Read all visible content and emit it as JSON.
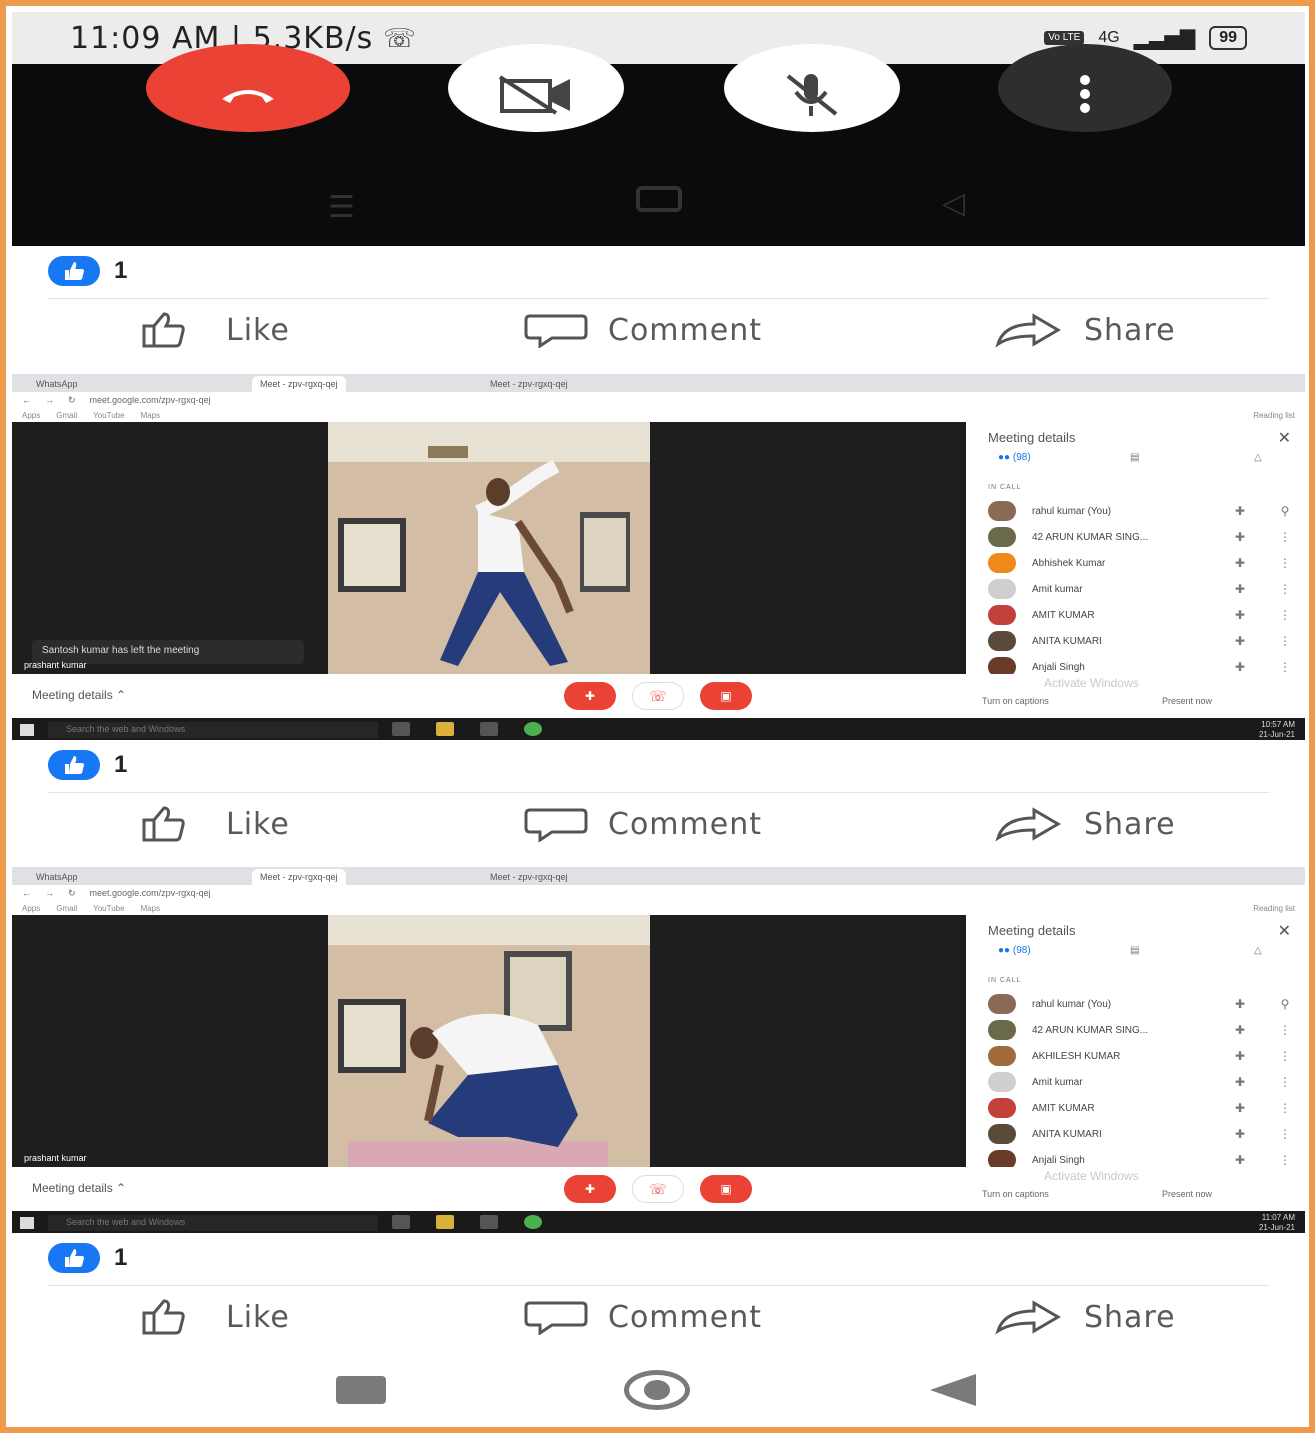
{
  "status_bar": {
    "time": "11:09 AM | 5.3KB/s",
    "network_type": "4G",
    "volte": "Vo LTE",
    "battery": "99"
  },
  "post_actions": {
    "like_count": "1",
    "like_label": "Like",
    "comment_label": "Comment",
    "share_label": "Share"
  },
  "meet_screens": [
    {
      "tabs": [
        "WhatsApp",
        "Meet - zpv-rgxq-qej",
        "Meet - zpv-rgxq-qej"
      ],
      "url": "meet.google.com/zpv-rgxq-qej",
      "bookmarks": [
        "Apps",
        "Gmail",
        "YouTube",
        "Maps",
        "Reading list"
      ],
      "notification": "Santosh kumar has left the meeting",
      "tile_name": "prashant kumar",
      "panel_title": "Meeting details",
      "people_count": "(98)",
      "in_call_label": "IN CALL",
      "participants": [
        "rahul kumar (You)",
        "42 ARUN KUMAR SING...",
        "Abhishek Kumar",
        "Amit kumar",
        "AMIT KUMAR",
        "ANITA KUMARI",
        "Anjali Singh"
      ],
      "meeting_details_label": "Meeting details",
      "captions_label": "Turn on captions",
      "present_label": "Present now",
      "watermark": "Activate Windows",
      "taskbar_search": "Search the web and Windows",
      "clock_time": "10:57 AM",
      "clock_date": "21-Jun-21"
    },
    {
      "tabs": [
        "WhatsApp",
        "Meet - zpv-rgxq-qej",
        "Meet - zpv-rgxq-qej"
      ],
      "url": "meet.google.com/zpv-rgxq-qej",
      "bookmarks": [
        "Apps",
        "Gmail",
        "YouTube",
        "Maps",
        "Reading list"
      ],
      "notification": "",
      "tile_name": "prashant kumar",
      "panel_title": "Meeting details",
      "people_count": "(98)",
      "in_call_label": "IN CALL",
      "participants": [
        "rahul kumar (You)",
        "42 ARUN KUMAR SING...",
        "AKHILESH KUMAR",
        "Amit kumar",
        "AMIT KUMAR",
        "ANITA KUMARI",
        "Anjali Singh"
      ],
      "meeting_details_label": "Meeting details",
      "captions_label": "Turn on captions",
      "present_label": "Present now",
      "watermark": "Activate Windows",
      "taskbar_search": "Search the web and Windows",
      "clock_time": "11:07 AM",
      "clock_date": "21-Jun-21"
    }
  ],
  "colors": {
    "frame": "#ee9a4d",
    "end_call": "#ea4335",
    "facebook_blue": "#1877f2"
  }
}
